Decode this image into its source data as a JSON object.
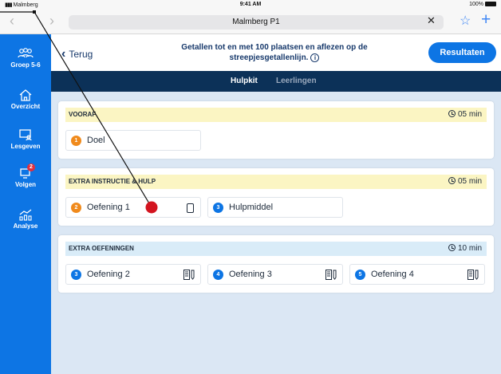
{
  "status_bar": {
    "carrier": "Malmberg",
    "time": "9:41 AM",
    "battery": "100%"
  },
  "browser": {
    "url_title": "Malmberg P1",
    "back_arrow": "‹",
    "forward_arrow": "›",
    "clear_label": "✕",
    "bookmark_label": "☆",
    "new_tab_label": "+"
  },
  "sidebar": {
    "items": [
      {
        "label": "Groep 5-6",
        "icon": "group-icon"
      },
      {
        "label": "Overzicht",
        "icon": "home-icon"
      },
      {
        "label": "Lesgeven",
        "icon": "presentation-icon"
      },
      {
        "label": "Volgen",
        "icon": "follow-icon",
        "badge": "2"
      },
      {
        "label": "Analyse",
        "icon": "analysis-icon"
      }
    ]
  },
  "header": {
    "back_label": "Terug",
    "back_chevron": "‹",
    "title_line1": "Getallen tot en met 100 plaatsen en aflezen op de",
    "title_line2": "streepjesgetallenlijn.",
    "info_glyph": "i",
    "results_label": "Resultaten"
  },
  "tabs": [
    {
      "label": "Hulpkit",
      "active": true
    },
    {
      "label": "Leerlingen",
      "active": false
    }
  ],
  "sections": [
    {
      "title": "VOORAF",
      "time": "05 min",
      "color": "#fbf5c3",
      "cards": [
        {
          "number": "1",
          "label": "Doel",
          "num_color": "orange"
        }
      ]
    },
    {
      "title": "EXTRA INSTRUCTIE & HULP",
      "time": "05 min",
      "color": "#fbf5c3",
      "cards": [
        {
          "number": "2",
          "label": "Oefening 1",
          "num_color": "orange",
          "icon": "tablet-icon"
        },
        {
          "number": "3",
          "label": "Hulpmiddel",
          "num_color": "blue"
        }
      ]
    },
    {
      "title": "EXTRA OEFENINGEN",
      "time": "10 min",
      "color": "#d9ecf8",
      "cards": [
        {
          "number": "3",
          "label": "Oefening 2",
          "num_color": "blue",
          "icon": "worksheet-icon"
        },
        {
          "number": "4",
          "label": "Oefening 3",
          "num_color": "blue",
          "icon": "worksheet-icon"
        },
        {
          "number": "5",
          "label": "Oefening 4",
          "num_color": "blue",
          "icon": "worksheet-icon"
        }
      ]
    }
  ],
  "colors": {
    "brand_blue": "#0d75e4",
    "navy": "#0c3158",
    "background": "#dbe7f4",
    "pointer": "#d3141f"
  }
}
